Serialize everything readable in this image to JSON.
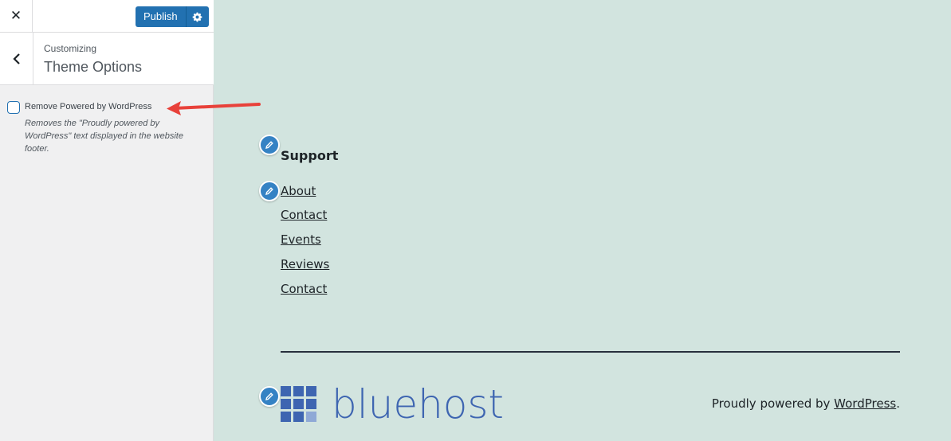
{
  "header": {
    "publish_label": "Publish",
    "close_icon": "close-icon",
    "settings_icon": "gear-icon"
  },
  "section": {
    "customizing_label": "Customizing",
    "title": "Theme Options"
  },
  "option": {
    "label": "Remove Powered by WordPress",
    "description": "Removes the \"Proudly powered by WordPress\" text displayed in the website footer.",
    "checked": false
  },
  "preview": {
    "footer_heading": "Support",
    "nav_links": [
      "About",
      "Contact",
      "Events",
      "Reviews",
      "Contact"
    ],
    "logo_text": "bluehost",
    "powered_prefix": "Proudly powered by ",
    "powered_link": "WordPress",
    "powered_suffix": "."
  },
  "colors": {
    "accent": "#2271b1",
    "preview_bg": "#d2e4df",
    "logo": "#3e65b1",
    "arrow": "#e8413a"
  }
}
